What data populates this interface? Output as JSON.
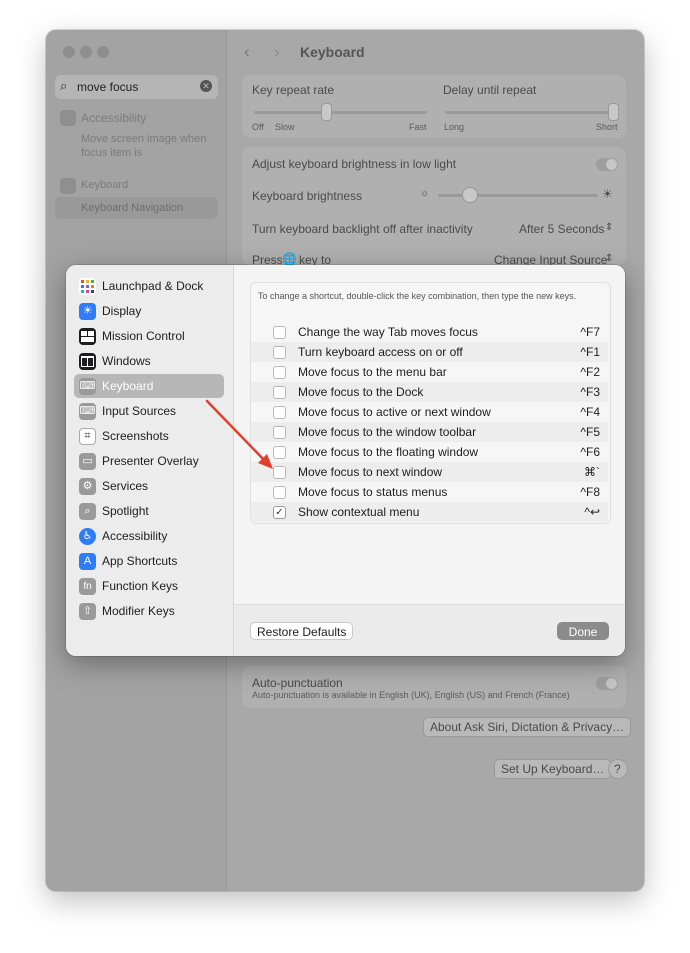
{
  "background": {
    "sidebar": {
      "search_value": "move focus",
      "results": [
        {
          "label": "Accessibility",
          "desc_line1": "Move screen image when",
          "desc_line2": "focus item is"
        },
        {
          "label": "Keyboard",
          "sub": "Keyboard Navigation"
        }
      ]
    },
    "title": "Keyboard",
    "key_repeat": {
      "label": "Key repeat rate",
      "min1": "Off",
      "min2": "Slow",
      "max": "Fast"
    },
    "delay": {
      "label": "Delay until repeat",
      "min": "Long",
      "max": "Short"
    },
    "brightness_low_light": "Adjust keyboard brightness in low light",
    "brightness": "Keyboard brightness",
    "backlight_off": {
      "label": "Turn keyboard backlight off after inactivity",
      "value": "After 5 Seconds"
    },
    "press_key": {
      "label_pre": "Press",
      "label_post": "key to",
      "value": "Change Input Source"
    },
    "auto_punct": {
      "label": "Auto-punctuation",
      "desc": "Auto-punctuation is available in English (UK), English (US) and French (France)"
    },
    "about_btn": "About Ask Siri, Dictation & Privacy…",
    "setup_btn": "Set Up Keyboard…",
    "help_btn": "?"
  },
  "sheet": {
    "categories": [
      {
        "label": "Launchpad & Dock",
        "icon": "launchpad-icon",
        "color": "#ffffff"
      },
      {
        "label": "Display",
        "icon": "display-icon",
        "color": "#2e7cf6"
      },
      {
        "label": "Mission Control",
        "icon": "mission-control-icon",
        "color": "#1d1d1f"
      },
      {
        "label": "Windows",
        "icon": "windows-icon",
        "color": "#1d1d1f"
      },
      {
        "label": "Keyboard",
        "icon": "keyboard-icon",
        "color": "#9a9a9a"
      },
      {
        "label": "Input Sources",
        "icon": "input-sources-icon",
        "color": "#9a9a9a"
      },
      {
        "label": "Screenshots",
        "icon": "screenshots-icon",
        "color": "#ffffff"
      },
      {
        "label": "Presenter Overlay",
        "icon": "presenter-overlay-icon",
        "color": "#9a9a9a"
      },
      {
        "label": "Services",
        "icon": "services-icon",
        "color": "#9a9a9a"
      },
      {
        "label": "Spotlight",
        "icon": "spotlight-icon",
        "color": "#9a9a9a"
      },
      {
        "label": "Accessibility",
        "icon": "accessibility-icon",
        "color": "#2e7cf6"
      },
      {
        "label": "App Shortcuts",
        "icon": "app-shortcuts-icon",
        "color": "#2e7cf6"
      },
      {
        "label": "Function Keys",
        "icon": "function-keys-icon",
        "color": "#9a9a9a"
      },
      {
        "label": "Modifier Keys",
        "icon": "modifier-keys-icon",
        "color": "#9a9a9a"
      }
    ],
    "selected_category": "Keyboard",
    "hint": "To change a shortcut, double-click the key combination, then type the new keys.",
    "shortcuts": [
      {
        "label": "Change the way Tab moves focus",
        "key": "^F7",
        "checked": false
      },
      {
        "label": "Turn keyboard access on or off",
        "key": "^F1",
        "checked": false
      },
      {
        "label": "Move focus to the menu bar",
        "key": "^F2",
        "checked": false
      },
      {
        "label": "Move focus to the Dock",
        "key": "^F3",
        "checked": false
      },
      {
        "label": "Move focus to active or next window",
        "key": "^F4",
        "checked": false
      },
      {
        "label": "Move focus to the window toolbar",
        "key": "^F5",
        "checked": false
      },
      {
        "label": "Move focus to the floating window",
        "key": "^F6",
        "checked": false
      },
      {
        "label": "Move focus to next window",
        "key": "⌘`",
        "checked": false
      },
      {
        "label": "Move focus to status menus",
        "key": "^F8",
        "checked": false
      },
      {
        "label": "Show contextual menu",
        "key": "^↩",
        "checked": true
      }
    ],
    "restore_btn": "Restore Defaults",
    "done_btn": "Done"
  },
  "annotation": {
    "color": "#e0402b"
  }
}
